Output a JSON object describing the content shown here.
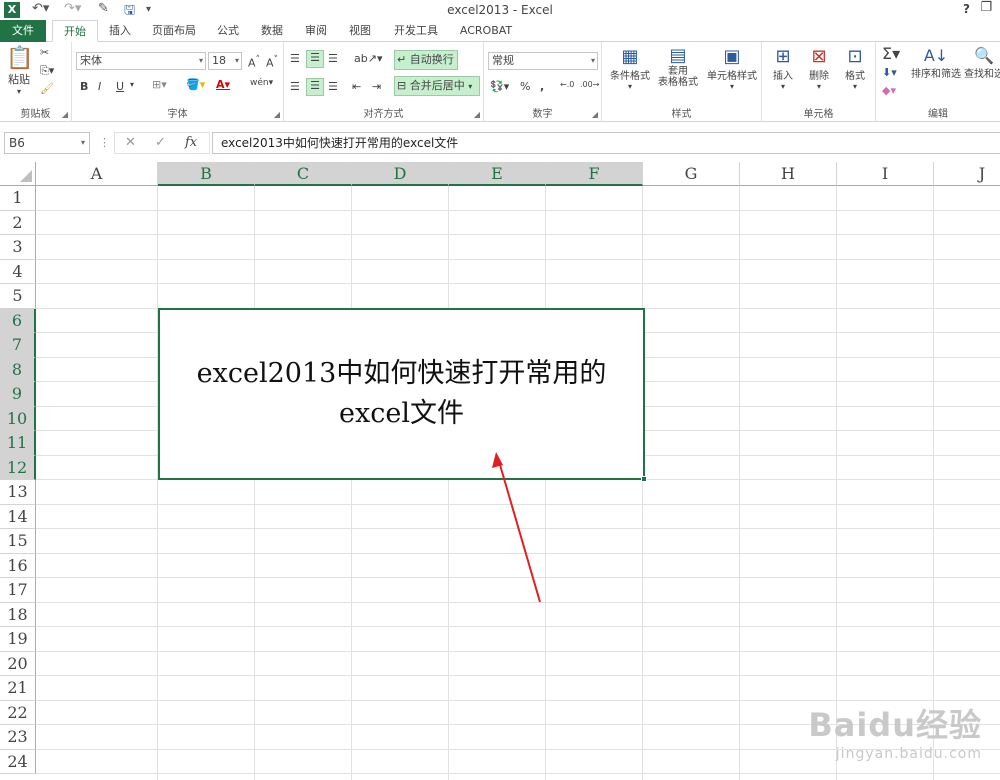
{
  "titlebar": {
    "app_icon": "X",
    "title": "excel2013 - Excel",
    "help": "?",
    "restore": "❐"
  },
  "tabs": [
    {
      "label": "文件"
    },
    {
      "label": "开始"
    },
    {
      "label": "插入"
    },
    {
      "label": "页面布局"
    },
    {
      "label": "公式"
    },
    {
      "label": "数据"
    },
    {
      "label": "审阅"
    },
    {
      "label": "视图"
    },
    {
      "label": "开发工具"
    },
    {
      "label": "ACROBAT"
    }
  ],
  "ribbon": {
    "clipboard": {
      "paste": "粘贴",
      "label": "剪贴板"
    },
    "font": {
      "name": "宋体",
      "size": "18",
      "bold": "B",
      "italic": "I",
      "underline": "U",
      "label": "字体"
    },
    "alignment": {
      "wrap": "自动换行",
      "merge": "合并后居中",
      "label": "对齐方式"
    },
    "number": {
      "format": "常规",
      "percent": "%",
      "comma": ",",
      "label": "数字"
    },
    "styles": {
      "conditional": "条件格式",
      "table1": "套用",
      "table2": "表格格式",
      "cell_styles": "单元格样式",
      "label": "样式"
    },
    "cells": {
      "insert": "插入",
      "delete": "删除",
      "format": "格式",
      "label": "单元格"
    },
    "editing": {
      "sort": "排序和筛选",
      "find": "查找和选",
      "label": "编辑"
    }
  },
  "formula_bar": {
    "name_box": "B6",
    "cancel": "✕",
    "enter": "✓",
    "fx": "fx",
    "content": "excel2013中如何快速打开常用的excel文件"
  },
  "grid": {
    "columns": [
      "A",
      "B",
      "C",
      "D",
      "E",
      "F",
      "G",
      "H",
      "I",
      "J"
    ],
    "rows": [
      "1",
      "2",
      "3",
      "4",
      "5",
      "6",
      "7",
      "8",
      "9",
      "10",
      "11",
      "12",
      "13",
      "14",
      "15",
      "16",
      "17",
      "18",
      "19",
      "20",
      "21",
      "22",
      "23",
      "24"
    ],
    "merged_cell_text": "excel2013中如何快速打开常用的excel文件"
  },
  "watermark": {
    "brand": "Baidu经验",
    "url": "jingyan.baidu.com"
  },
  "colors": {
    "accent": "#217346",
    "arrow": "#e02020"
  }
}
